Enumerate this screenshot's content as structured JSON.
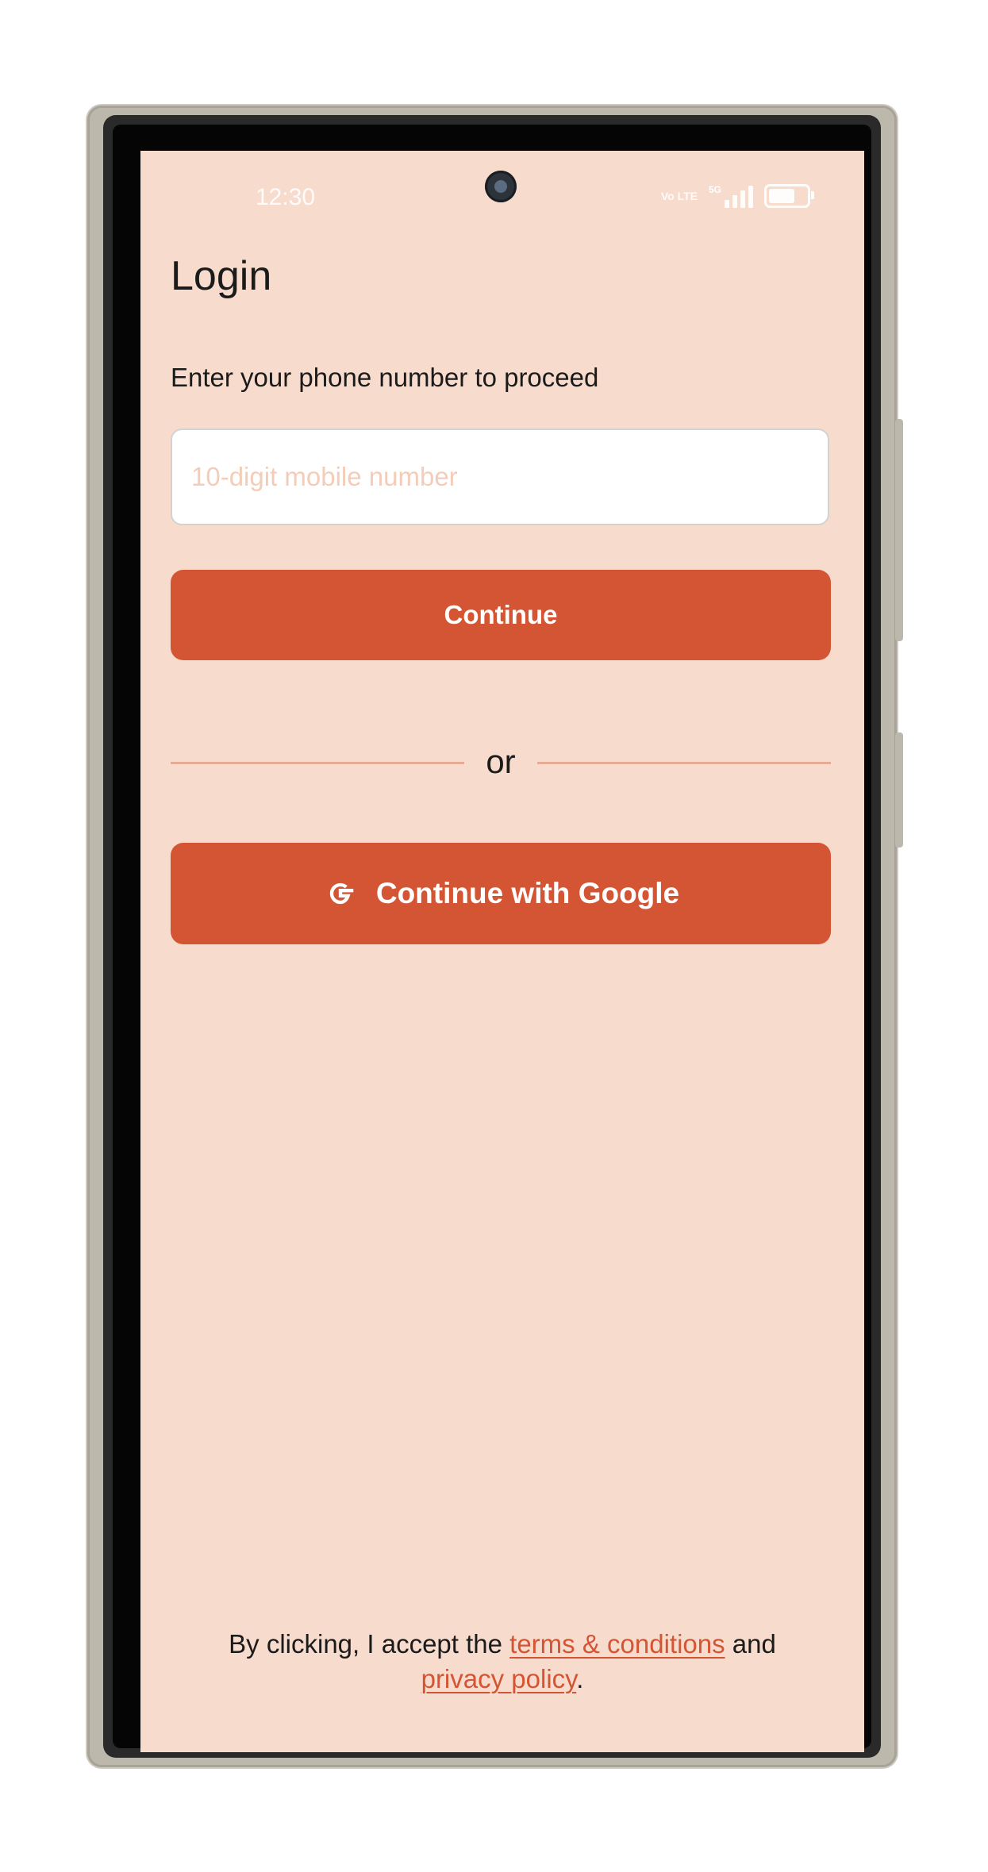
{
  "status_bar": {
    "time": "12:30",
    "network_badge": "Vo LTE",
    "network_type": "5G",
    "icons": [
      "signal-icon",
      "battery-icon"
    ],
    "battery_level": 0.7
  },
  "login": {
    "title": "Login",
    "subtitle": "Enter your phone number to proceed",
    "phone_placeholder": "10-digit mobile number",
    "phone_value": "",
    "continue_label": "Continue",
    "divider_text": "or",
    "google_label": "Continue with Google",
    "google_icon": "google-g-icon"
  },
  "legal": {
    "prefix": "By clicking, I accept the ",
    "terms_link": "terms & conditions",
    "middle": " and ",
    "privacy_link": "privacy policy",
    "suffix": "."
  },
  "colors": {
    "screen_background": "#f7dccd",
    "accent": "#d45533",
    "divider": "#e6ab95",
    "text": "#1b1b1b",
    "placeholder": "#f4cdb9"
  }
}
